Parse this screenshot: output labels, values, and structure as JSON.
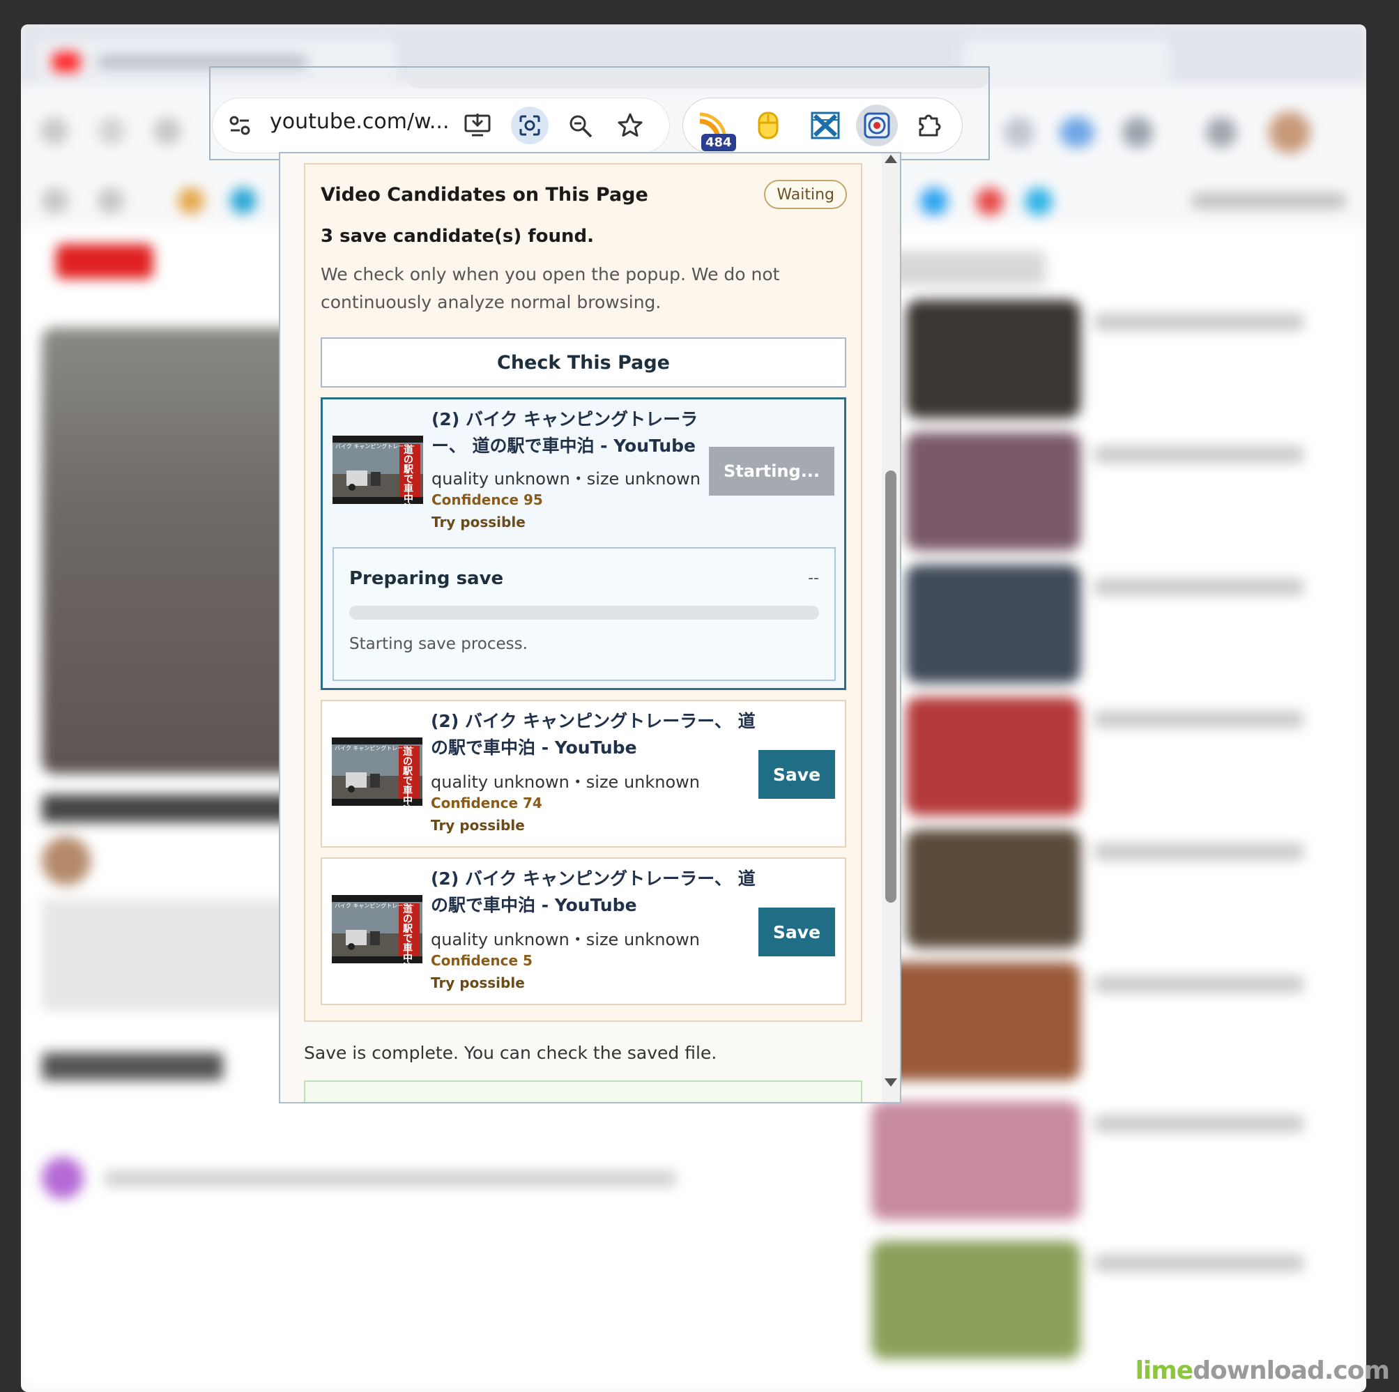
{
  "browser": {
    "url_display": "youtube.com/w...",
    "extension_badge": "484"
  },
  "popup": {
    "title": "Video Candidates on This Page",
    "status": "Waiting",
    "found_text": "3 save candidate(s) found.",
    "note": "We check only when you open the popup. We do not continuously analyze normal browsing.",
    "check_button": "Check This Page",
    "candidates": [
      {
        "title_line1": "(2) バイク キャンピングトレーラ",
        "title_line2": "ー、 道の駅で車中泊 - YouTube",
        "meta": "quality unknown・size unknown",
        "confidence": "Confidence 95",
        "try": "Try possible",
        "button": "Starting..."
      },
      {
        "title_line1": "(2) バイク キャンピングトレーラー、 道",
        "title_line2": "の駅で車中泊 - YouTube",
        "meta": "quality unknown・size unknown",
        "confidence": "Confidence 74",
        "try": "Try possible",
        "button": "Save"
      },
      {
        "title_line1": "(2) バイク キャンピングトレーラー、 道",
        "title_line2": "の駅で車中泊 - YouTube",
        "meta": "quality unknown・size unknown",
        "confidence": "Confidence 5",
        "try": "Try possible",
        "button": "Save"
      }
    ],
    "progress": {
      "title": "Preparing save",
      "percent_text": "--",
      "fraction": 0,
      "message": "Starting save process."
    },
    "complete_text": "Save is complete. You can check the saved file."
  },
  "thumbnail": {
    "overlay_text_small": "バイク キャンピングトレーラー",
    "overlay_text_vertical": "道の駅で車中泊"
  },
  "watermark": {
    "part1": "lime",
    "part2": "download.com"
  },
  "colors": {
    "accent": "#1f6e85",
    "panel_bg": "#fcf6ec",
    "panel_border": "#e6d3b8",
    "confidence": "#8a5a18"
  }
}
